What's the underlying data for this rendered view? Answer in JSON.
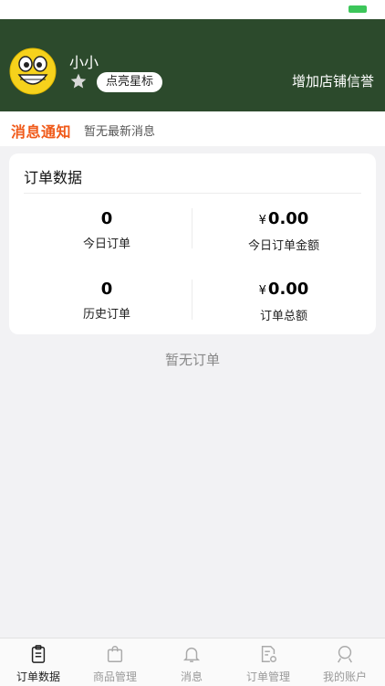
{
  "profile": {
    "name": "小小",
    "light_star_label": "点亮星标",
    "increase_credit_label": "增加店铺信誉"
  },
  "notice": {
    "logo_text": "消息通知",
    "text": "暂无最新消息"
  },
  "order_data": {
    "title": "订单数据",
    "stats": [
      {
        "value": "0",
        "label": "今日订单"
      },
      {
        "currency": "¥",
        "value": "0.00",
        "label": "今日订单金额"
      },
      {
        "value": "0",
        "label": "历史订单"
      },
      {
        "currency": "¥",
        "value": "0.00",
        "label": "订单总额"
      }
    ]
  },
  "empty_text": "暂无订单",
  "tabbar": {
    "items": [
      {
        "label": "订单数据",
        "icon": "clipboard-icon",
        "active": true
      },
      {
        "label": "商品管理",
        "icon": "shopping-bag-icon",
        "active": false
      },
      {
        "label": "消息",
        "icon": "bell-icon",
        "active": false
      },
      {
        "label": "订单管理",
        "icon": "document-settings-icon",
        "active": false
      },
      {
        "label": "我的账户",
        "icon": "user-icon",
        "active": false
      }
    ]
  },
  "colors": {
    "header_bg": "#2c4a2c",
    "notice_logo": "#f05a1a",
    "battery": "#3cc65a"
  }
}
